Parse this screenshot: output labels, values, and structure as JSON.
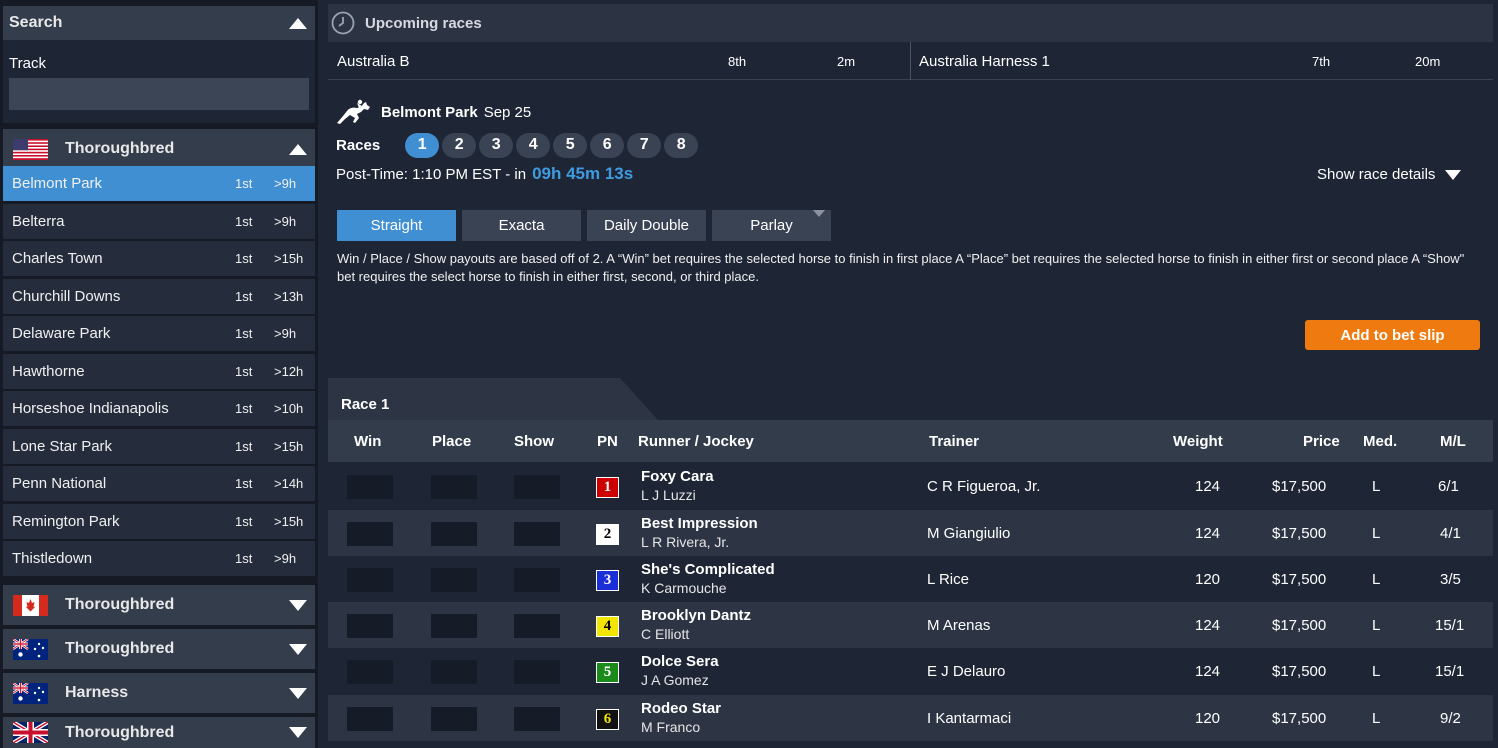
{
  "sidebar": {
    "search_title": "Search",
    "track_label": "Track",
    "track_placeholder": "",
    "groups": [
      {
        "flag": "us-flag-icon",
        "label": "Thoroughbred",
        "expanded": true
      },
      {
        "flag": "canada-flag-icon",
        "label": "Thoroughbred",
        "expanded": false
      },
      {
        "flag": "australia-flag-icon",
        "label": "Thoroughbred",
        "expanded": false
      },
      {
        "flag": "australia-flag-icon",
        "label": "Harness",
        "expanded": false
      },
      {
        "flag": "uk-flag-icon",
        "label": "Thoroughbred",
        "expanded": false
      }
    ],
    "tracks": [
      {
        "name": "Belmont Park",
        "pos": "1st",
        "time": ">9h",
        "active": true
      },
      {
        "name": "Belterra",
        "pos": "1st",
        "time": ">9h"
      },
      {
        "name": "Charles Town",
        "pos": "1st",
        "time": ">15h"
      },
      {
        "name": "Churchill Downs",
        "pos": "1st",
        "time": ">13h"
      },
      {
        "name": "Delaware Park",
        "pos": "1st",
        "time": ">9h"
      },
      {
        "name": "Hawthorne",
        "pos": "1st",
        "time": ">12h"
      },
      {
        "name": "Horseshoe Indianapolis",
        "pos": "1st",
        "time": ">10h"
      },
      {
        "name": "Lone Star Park",
        "pos": "1st",
        "time": ">15h"
      },
      {
        "name": "Penn National",
        "pos": "1st",
        "time": ">14h"
      },
      {
        "name": "Remington Park",
        "pos": "1st",
        "time": ">15h"
      },
      {
        "name": "Thistledown",
        "pos": "1st",
        "time": ">9h"
      }
    ]
  },
  "upcoming": {
    "title": "Upcoming races",
    "items": [
      {
        "name": "Australia B",
        "race": "8th",
        "time": "2m"
      },
      {
        "name": "Australia Harness 1",
        "race": "7th",
        "time": "20m"
      }
    ]
  },
  "meeting": {
    "name": "Belmont Park",
    "date": "Sep 25",
    "races_label": "Races",
    "races": [
      "1",
      "2",
      "3",
      "4",
      "5",
      "6",
      "7",
      "8"
    ],
    "active_race": "1",
    "post_time_label": "Post-Time: 1:10 PM EST - in",
    "countdown": "09h 45m 13s",
    "show_details": "Show race details"
  },
  "bet_types": [
    "Straight",
    "Exacta",
    "Daily Double",
    "Parlay"
  ],
  "bet_description": "Win / Place / Show payouts are based off of 2. A “Win” bet requires the selected horse to finish in first place A “Place” bet requires the selected horse to finish in either first or second place A “Show\" bet requires the select horse to finish in either first, second, or third place.",
  "add_slip_label": "Add to bet slip",
  "race": {
    "title": "Race 1",
    "columns": {
      "win": "Win",
      "place": "Place",
      "show": "Show",
      "pn": "PN",
      "runner": "Runner / Jockey",
      "trainer": "Trainer",
      "weight": "Weight",
      "price": "Price",
      "med": "Med.",
      "ml": "M/L"
    },
    "runners": [
      {
        "pn": "1",
        "pn_bg": "#cc0000",
        "pn_fg": "#ffffff",
        "name": "Foxy Cara",
        "jockey": "L J Luzzi",
        "trainer": "C R Figueroa, Jr.",
        "weight": "124",
        "price": "$17,500",
        "med": "L",
        "ml": "6/1"
      },
      {
        "pn": "2",
        "pn_bg": "#ffffff",
        "pn_fg": "#000000",
        "name": "Best Impression",
        "jockey": "L R Rivera, Jr.",
        "trainer": "M Giangiulio",
        "weight": "124",
        "price": "$17,500",
        "med": "L",
        "ml": "4/1"
      },
      {
        "pn": "3",
        "pn_bg": "#1a2ed8",
        "pn_fg": "#ffffff",
        "name": "She's Complicated",
        "jockey": "K Carmouche",
        "trainer": "L Rice",
        "weight": "120",
        "price": "$17,500",
        "med": "L",
        "ml": "3/5"
      },
      {
        "pn": "4",
        "pn_bg": "#f2e600",
        "pn_fg": "#000000",
        "name": "Brooklyn Dantz",
        "jockey": "C Elliott",
        "trainer": "M Arenas",
        "weight": "124",
        "price": "$17,500",
        "med": "L",
        "ml": "15/1"
      },
      {
        "pn": "5",
        "pn_bg": "#1a8a1a",
        "pn_fg": "#ffffff",
        "name": "Dolce Sera",
        "jockey": "J A Gomez",
        "trainer": "E J Delauro",
        "weight": "124",
        "price": "$17,500",
        "med": "L",
        "ml": "15/1"
      },
      {
        "pn": "6",
        "pn_bg": "#111111",
        "pn_fg": "#f2e600",
        "name": "Rodeo Star",
        "jockey": "M Franco",
        "trainer": "I Kantarmaci",
        "weight": "120",
        "price": "$17,500",
        "med": "L",
        "ml": "9/2"
      }
    ]
  },
  "colors": {
    "accent": "#3f8fd2",
    "orange": "#ee7a10",
    "panel": "#1e2535"
  }
}
